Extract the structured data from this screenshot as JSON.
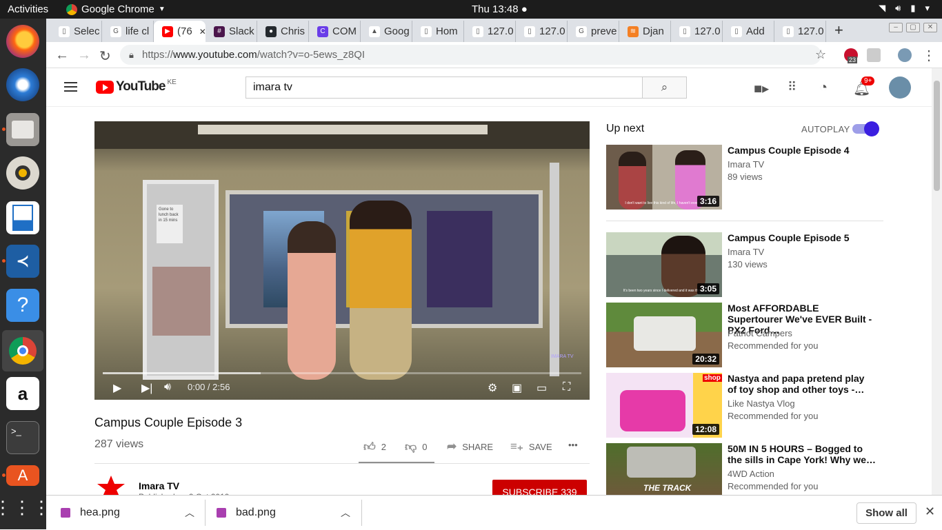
{
  "topbar": {
    "activities": "Activities",
    "app_name": "Google Chrome",
    "clock": "Thu 13:48 ●"
  },
  "tabs": [
    {
      "label": "Selec",
      "icon": "document-icon"
    },
    {
      "label": "life cl",
      "icon": "google-icon"
    },
    {
      "label": "(76",
      "icon": "youtube-icon",
      "active": true
    },
    {
      "label": "Slack",
      "icon": "slack-icon"
    },
    {
      "label": "Chris",
      "icon": "github-icon"
    },
    {
      "label": "COM",
      "icon": "circle-c-icon"
    },
    {
      "label": "Goog",
      "icon": "drive-icon"
    },
    {
      "label": "Hom",
      "icon": "document-icon"
    },
    {
      "label": "127.0",
      "icon": "document-icon"
    },
    {
      "label": "127.0",
      "icon": "document-icon"
    },
    {
      "label": "preve",
      "icon": "google-icon"
    },
    {
      "label": "Djan",
      "icon": "stack-icon"
    },
    {
      "label": "127.0",
      "icon": "document-icon"
    },
    {
      "label": "Add",
      "icon": "document-icon"
    },
    {
      "label": "127.0",
      "icon": "document-icon"
    }
  ],
  "address": {
    "scheme": "https://",
    "host": "www.youtube.com",
    "path": "/watch?v=o-5ews_z8QI"
  },
  "extensions": {
    "abp_count": "23"
  },
  "youtube": {
    "logo_text": "YouTube",
    "country": "KE",
    "search_query": "imara tv",
    "notifications": "9+"
  },
  "video": {
    "time": "0:00 / 2:56",
    "title": "Campus Couple Episode 3",
    "views": "287 views",
    "likes": "2",
    "dislikes": "0",
    "share": "SHARE",
    "save": "SAVE",
    "more": "•••",
    "progress_loaded_fraction": 0.33,
    "poster_text_1": "Gone to lunch back in 15 mins",
    "watermark": "IMARA TV"
  },
  "channel": {
    "name": "Imara TV",
    "published": "Published on 2 Oct 2019",
    "subscribe": "SUBSCRIBE",
    "subscribers": "339"
  },
  "sidebar": {
    "up_next": "Up next",
    "autoplay": "AUTOPLAY",
    "autoplay_on": true,
    "items": [
      {
        "title": "Campus Couple Episode 4",
        "channel": "Imara TV",
        "meta": "89 views",
        "duration": "3:16",
        "caption": "I don't want to live this kind of life, I haven't even ex"
      },
      {
        "title": "Campus Couple Episode 5",
        "channel": "Imara TV",
        "meta": "130 views",
        "duration": "3:05",
        "caption": "It's been two years since I delivered and it was throug"
      },
      {
        "title": "Most AFFORDABLE Supertourer We've EVER Built - PX2 Ford…",
        "channel": "Patriot Campers",
        "meta": "Recommended for you",
        "duration": "20:32"
      },
      {
        "title": "Nastya and papa pretend play of toy shop and other toys -…",
        "channel": "Like Nastya Vlog",
        "meta": "Recommended for you",
        "duration": "12:08",
        "thumb_text": "shop"
      },
      {
        "title": "50M IN 5 HOURS – Bogged to the sills in Cape York! Why we…",
        "channel": "4WD Action",
        "meta": "Recommended for you",
        "thumb_text": "THE TRACK"
      }
    ]
  },
  "downloads": {
    "items": [
      "hea.png",
      "bad.png"
    ],
    "show_all": "Show all"
  }
}
